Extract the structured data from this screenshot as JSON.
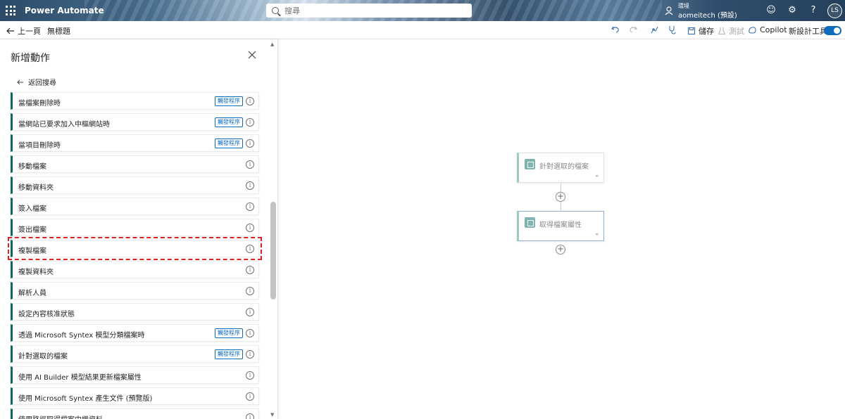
{
  "header": {
    "app_name": "Power Automate",
    "search_placeholder": "搜尋",
    "environment_label": "環境",
    "environment_name": "aomeitech (預設)",
    "avatar_initials": "LS"
  },
  "commandbar": {
    "back_label": "上一頁",
    "flow_name": "無標題",
    "save_label": "儲存",
    "test_label": "測試",
    "copilot_label": "Copilot",
    "new_designer_label": "新設計工具",
    "new_designer_on": true
  },
  "panel": {
    "title": "新增動作",
    "back_to_search": "返回搜尋",
    "items": [
      {
        "label": "當檔案刪除時",
        "badge": "觸發程序"
      },
      {
        "label": "當網站已要求加入中樞網站時",
        "badge": "觸發程序"
      },
      {
        "label": "當項目刪除時",
        "badge": "觸發程序"
      },
      {
        "label": "移動檔案",
        "badge": ""
      },
      {
        "label": "移動資料夾",
        "badge": ""
      },
      {
        "label": "簽入檔案",
        "badge": ""
      },
      {
        "label": "簽出檔案",
        "badge": ""
      },
      {
        "label": "複製檔案",
        "badge": "",
        "highlighted": true
      },
      {
        "label": "複製資料夾",
        "badge": ""
      },
      {
        "label": "解析人員",
        "badge": ""
      },
      {
        "label": "設定內容核准狀態",
        "badge": ""
      },
      {
        "label": "透過 Microsoft Syntex 模型分類檔案時",
        "badge": "觸發程序"
      },
      {
        "label": "針對選取的檔案",
        "badge": "觸發程序"
      },
      {
        "label": "使用 AI Builder 模型結果更新檔案屬性",
        "badge": ""
      },
      {
        "label": "使用 Microsoft Syntex 產生文件 (預覽版)",
        "badge": ""
      },
      {
        "label": "使用路徑取得檔案中繼資料",
        "badge": ""
      }
    ]
  },
  "canvas": {
    "nodes": [
      {
        "title": "針對選取的檔案"
      },
      {
        "title": "取得檔案屬性"
      }
    ]
  },
  "colors": {
    "accent": "#0f6cbd",
    "item_bar": "#0b6a5f",
    "highlight": "#d92222"
  }
}
